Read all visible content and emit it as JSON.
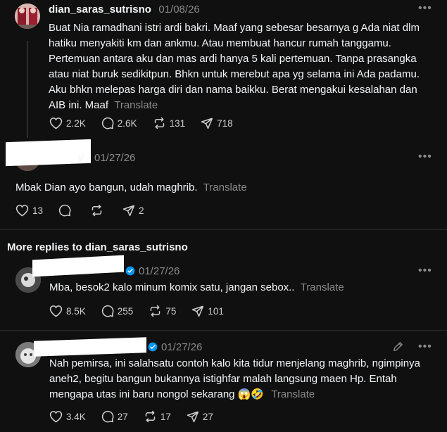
{
  "post": {
    "username": "dian_saras_sutrisno",
    "time": "01/08/26",
    "text": "Buat Nia ramadhani istri ardi bakri. Maaf yang sebesar besarnya g Ada niat dlm hatiku menyakiti km dan ankmu. Atau membuat hancur rumah tanggamu. Pertemuan antara aku dan mas ardi hanya 5 kali pertemuan. Tanpa prasangka atau niat buruk sedikitpun. Bhkn untuk merebut apa yg selama ini Ada padamu. Aku bhkn melepas harga diri dan nama baikku. Berat mengakui kesalahan dan AIB ini. Maaf",
    "translate": "Translate",
    "likes": "2.2K",
    "replies": "2.6K",
    "reposts": "131",
    "shares": "718"
  },
  "reply1": {
    "username_visible": "y",
    "time": "01/27/26",
    "text": "Mbak Dian ayo bangun, udah maghrib.",
    "translate": "Translate",
    "likes": "13",
    "shares": "2"
  },
  "section": {
    "title": "More replies to dian_saras_sutrisno"
  },
  "reply2": {
    "time": "01/27/26",
    "text": "Mba, besok2 kalo minum komix satu, jangan sebox..",
    "translate": "Translate",
    "likes": "8.5K",
    "replies": "255",
    "reposts": "75",
    "shares": "101"
  },
  "reply3": {
    "time": "01/27/26",
    "text": "Nah pemirsa, ini salahsatu contoh kalo kita tidur menjelang maghrib, ngimpinya aneh2, begitu bangun bukannya istighfar malah langsung maen Hp. Entah mengapa utas ini baru nongol sekarang",
    "emoji": "😱🤣",
    "translate": "Translate",
    "likes": "3.4K",
    "replies": "27",
    "reposts": "17",
    "shares": "27"
  },
  "colors": {
    "background": "#101010",
    "text": "#f3f5f7",
    "muted": "#8a8a8a",
    "verified": "#0095f6"
  },
  "icons": [
    "more-icon",
    "heart-icon",
    "comment-icon",
    "repost-icon",
    "share-icon",
    "verified-icon",
    "edit-icon"
  ]
}
